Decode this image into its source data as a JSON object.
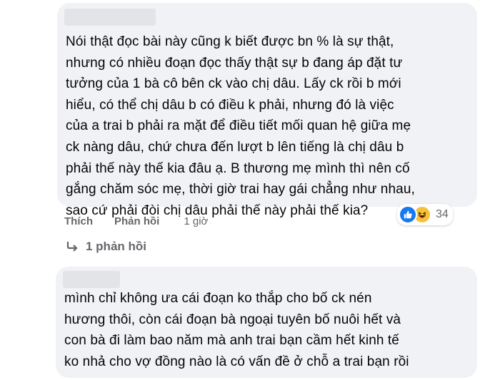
{
  "comment1": {
    "text": "Nói thật đọc bài này cũng k biết được bn % là sự thật,\nnhưng có nhiều đoạn đọc thấy thật sự b đang áp đặt tư\ntưởng của 1 bà cô bên ck vào chị dâu. Lấy ck rồi b mới\nhiểu, có thể chị dâu b có điều k phải, nhưng đó là việc\ncủa a trai b phải ra mặt để điều tiết mối quan hệ giữa mẹ\nck nàng dâu, chứ chưa đến lượt b lên tiếng là chị dâu b\nphải thế này thế kia đâu ạ. B thương mẹ mình thì nên cố\ngắng chăm sóc mẹ, thời giờ trai hay gái chẳng như nhau,\nsao cứ phải đòi chị dâu phải thế này phải thế kia?",
    "actions": {
      "like": "Thích",
      "reply": "Phản hồi",
      "time": "1 giờ"
    },
    "reactions": {
      "icons": [
        "like-icon",
        "haha-icon"
      ],
      "count": "34",
      "like_color": "#1877f2",
      "haha_color": "#f7c23b"
    },
    "replies_label": "1 phản hồi"
  },
  "comment2": {
    "text": "mình chỉ không ưa cái đoạn ko thắp cho bố ck nén\nhương thôi, còn cái đoạn bà ngoại tuyên bố nuôi hết và\ncon bà đi làm bao năm mà anh trai bạn cầm hết kinh tế\nko nhả cho vợ đồng nào là có vấn đề ở chỗ a trai bạn rồi"
  }
}
